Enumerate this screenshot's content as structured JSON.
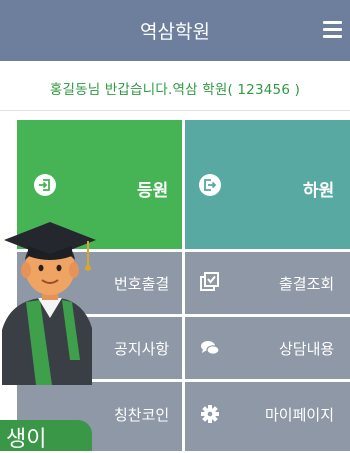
{
  "header": {
    "title": "역삼학원",
    "menu_icon": "hamburger-menu-icon"
  },
  "welcome": {
    "text": "홍길동님 반갑습니다.역삼 학원( 123456 )"
  },
  "tiles": {
    "checkin": {
      "label": "등원",
      "icon": "sign-in-icon"
    },
    "checkout": {
      "label": "하원",
      "icon": "sign-out-icon"
    },
    "number_attendance": {
      "label": "번호출결"
    },
    "attendance_lookup": {
      "label": "출결조회",
      "icon": "check-square-icon"
    },
    "notice": {
      "label": "공지사항"
    },
    "consult": {
      "label": "상담내용",
      "icon": "chat-bubbles-icon"
    },
    "praise_coin": {
      "label": "칭찬코인"
    },
    "mypage": {
      "label": "마이페이지",
      "icon": "gear-icon"
    }
  },
  "student_badge": {
    "text": "생이",
    "icon": "graduate-student-icon"
  },
  "colors": {
    "header": "#6d7f9c",
    "green": "#46b455",
    "teal": "#58a9a1",
    "gray_tile": "#8f98a6",
    "welcome_text": "#2e9a42"
  }
}
